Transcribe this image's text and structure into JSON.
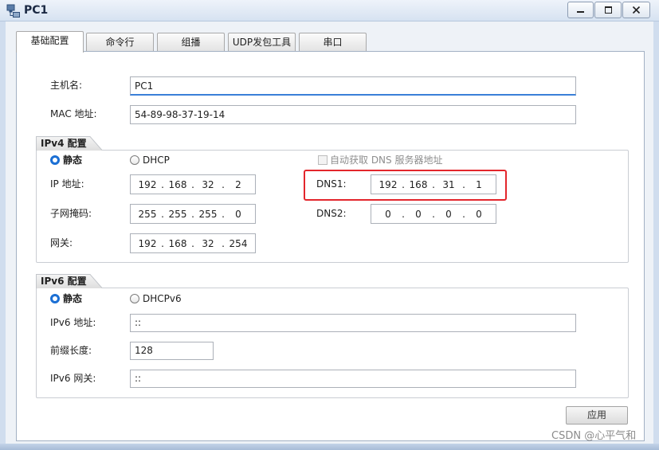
{
  "window": {
    "title": "PC1",
    "app_icon": "pc-network-icon",
    "controls": [
      "minimize-icon",
      "maximize-icon",
      "close-icon"
    ]
  },
  "tabs": [
    {
      "label": "基础配置",
      "active": true
    },
    {
      "label": "命令行",
      "active": false
    },
    {
      "label": "组播",
      "active": false
    },
    {
      "label": "UDP发包工具",
      "active": false
    },
    {
      "label": "串口",
      "active": false
    }
  ],
  "ip_separator": ".",
  "basic": {
    "hostname": {
      "label": "主机名:",
      "value": "PC1",
      "focused": true
    },
    "mac": {
      "label": "MAC 地址:",
      "value": "54-89-98-37-19-14"
    }
  },
  "ipv4": {
    "group_label": "IPv4 配置",
    "radios": [
      {
        "label": "静态",
        "checked": true
      },
      {
        "label": "DHCP",
        "checked": false
      }
    ],
    "auto_dns": {
      "label": "自动获取 DNS 服务器地址",
      "checked": false,
      "disabled": true
    },
    "ip": {
      "label": "IP 地址:",
      "octets": [
        "192",
        "168",
        "32",
        "2"
      ]
    },
    "mask": {
      "label": "子网掩码:",
      "octets": [
        "255",
        "255",
        "255",
        "0"
      ]
    },
    "gateway": {
      "label": "网关:",
      "octets": [
        "192",
        "168",
        "32",
        "254"
      ]
    },
    "dns1": {
      "label": "DNS1:",
      "octets": [
        "192",
        "168",
        "31",
        "1"
      ],
      "highlighted": true
    },
    "dns2": {
      "label": "DNS2:",
      "octets": [
        "0",
        "0",
        "0",
        "0"
      ]
    }
  },
  "ipv6": {
    "group_label": "IPv6 配置",
    "radios": [
      {
        "label": "静态",
        "checked": true
      },
      {
        "label": "DHCPv6",
        "checked": false
      }
    ],
    "address": {
      "label": "IPv6 地址:",
      "value": "::"
    },
    "prefix_length": {
      "label": "前缀长度:",
      "value": "128"
    },
    "gateway": {
      "label": "IPv6 网关:",
      "value": "::"
    }
  },
  "apply_button": {
    "label": "应用"
  },
  "watermark": "CSDN @心平气和",
  "colors": {
    "highlight": "#e3262c",
    "radio_selected": "#1b6fd4",
    "focus_underline": "#3a7fd8"
  }
}
